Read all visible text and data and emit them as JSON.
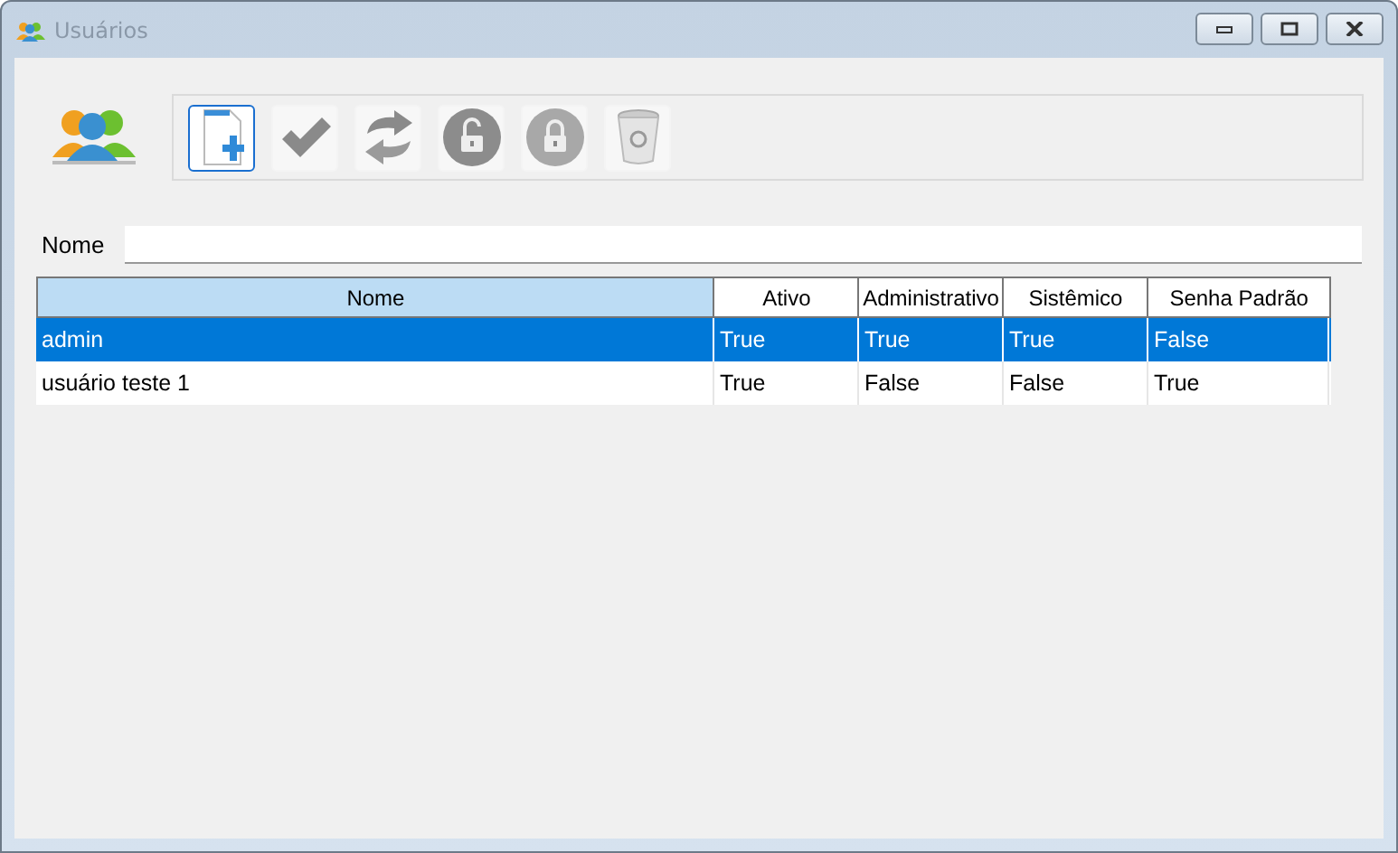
{
  "window": {
    "title": "Usuários"
  },
  "toolbar": [
    {
      "kind": "new",
      "selected": true
    },
    {
      "kind": "confirm",
      "selected": false
    },
    {
      "kind": "refresh",
      "selected": false
    },
    {
      "kind": "unlock",
      "selected": false
    },
    {
      "kind": "lock",
      "selected": false
    },
    {
      "kind": "trash",
      "selected": false
    }
  ],
  "filter": {
    "label": "Nome"
  },
  "table": {
    "columns": [
      {
        "label": "Nome",
        "selected": true
      },
      {
        "label": "Ativo",
        "selected": false
      },
      {
        "label": "Administrativo",
        "selected": false
      },
      {
        "label": "Sistêmico",
        "selected": false
      },
      {
        "label": "Senha Padrão",
        "selected": false
      }
    ],
    "rows": [
      {
        "selected": true,
        "cells": [
          "admin",
          "True",
          "True",
          "True",
          "False"
        ]
      },
      {
        "selected": false,
        "cells": [
          "usuário teste 1",
          "True",
          "False",
          "False",
          "True"
        ]
      }
    ]
  }
}
